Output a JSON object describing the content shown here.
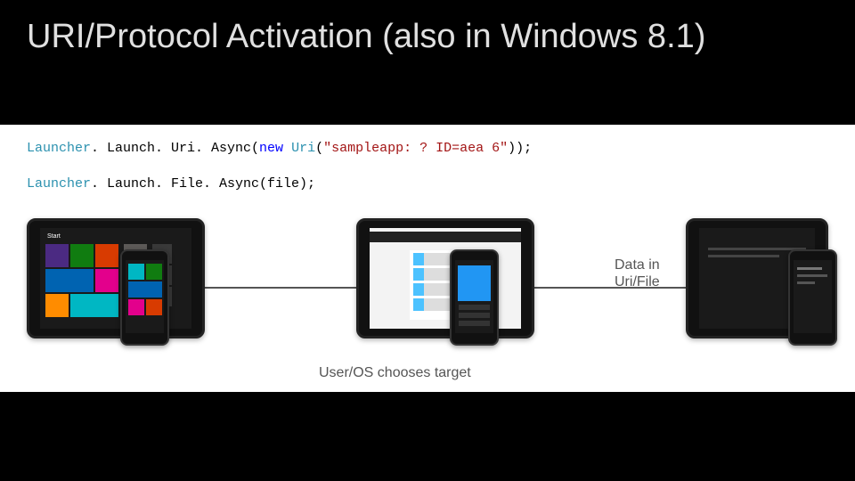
{
  "title": "URI/Protocol Activation (also in Windows 8.1)",
  "code": {
    "line1": {
      "p1": "Launcher",
      "p2": ". Launch. Uri. Async(",
      "kw": "new ",
      "type": "Uri",
      "p3": "(",
      "str": "\"sampleapp: ? ID=aea 6\"",
      "p4": "));"
    },
    "line2": {
      "p1": "Launcher",
      "p2": ". Launch. File. Async(file);"
    }
  },
  "annot": {
    "data": "Data in\nUri/File",
    "choose": "User/OS chooses target"
  },
  "startLabel": "Start"
}
